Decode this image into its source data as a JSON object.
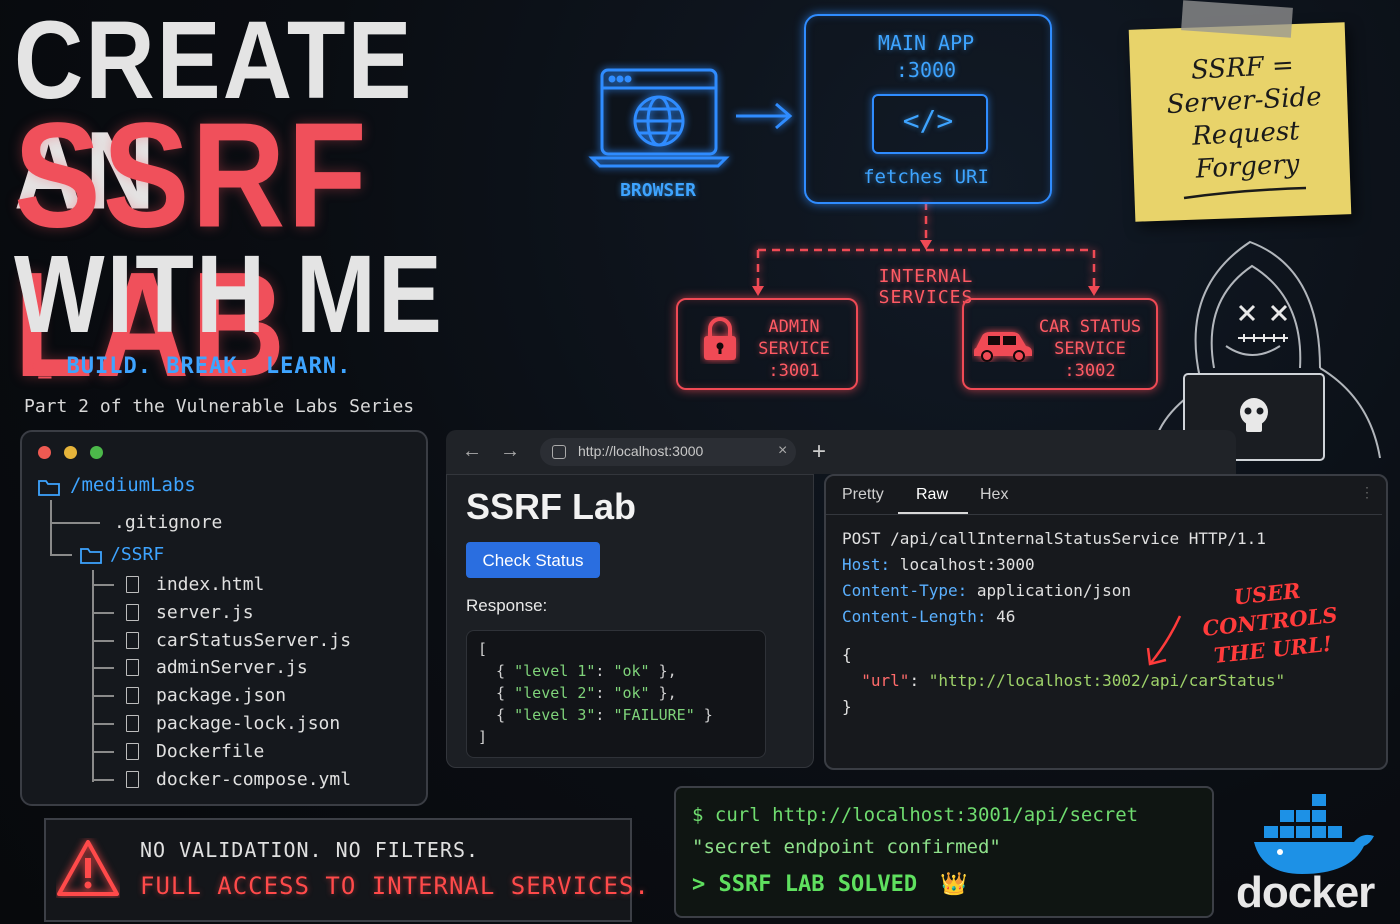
{
  "hero": {
    "line1": "CREATE AN",
    "line2": "SSRF LAB",
    "line3": "WITH ME",
    "tagline_prompt": ">_",
    "tagline": "BUILD. BREAK. LEARN.",
    "subtitle": "Part 2 of the Vulnerable Labs Series"
  },
  "diagram": {
    "browser_label": "BROWSER",
    "main_app_line1": "MAIN APP",
    "main_app_line2": ":3000",
    "code_glyph": "</>",
    "fetches_label": "fetches URI",
    "internal_label": "INTERNAL SERVICES",
    "admin_line1": "ADMIN",
    "admin_line2": "SERVICE",
    "admin_line3": ":3001",
    "car_line1": "CAR STATUS",
    "car_line2": "SERVICE",
    "car_line3": ":3002",
    "blue": "#2f8cff",
    "red": "#f04a55"
  },
  "sticky_note": {
    "line1": "SSRF =",
    "line2": "Server-Side",
    "line3": "Request",
    "line4": "Forgery"
  },
  "file_tree": {
    "root": "/mediumLabs",
    "gitignore": ".gitignore",
    "ssrf_folder": "/SSRF",
    "files": [
      "index.html",
      "server.js",
      "carStatusServer.js",
      "adminServer.js",
      "package.json",
      "package-lock.json",
      "Dockerfile",
      "docker-compose.yml"
    ]
  },
  "browser": {
    "url": "http://localhost:3000",
    "title": "SSRF Lab",
    "button_label": "Check Status",
    "response_label": "Response:",
    "response_open": "[",
    "response_rows": [
      {
        "key": "\"level 1\"",
        "value": "\"ok\"",
        "close": " },"
      },
      {
        "key": "\"level 2\"",
        "value": "\"ok\"",
        "close": " },"
      },
      {
        "key": "\"level 3\"",
        "value": "\"FAILURE\"",
        "close": " }"
      }
    ],
    "response_close": "]"
  },
  "request": {
    "tabs": [
      "Pretty",
      "Raw",
      "Hex"
    ],
    "active_tab": "Raw",
    "request_line": "POST /api/callInternalStatusService HTTP/1.1",
    "headers": [
      {
        "key": "Host:",
        "value": " localhost:3000"
      },
      {
        "key": "Content-Type:",
        "value": " application/json"
      },
      {
        "key": "Content-Length:",
        "value": " 46"
      }
    ],
    "body_open": "{",
    "body_key": "\"url\"",
    "body_value": "\"http://localhost:3002/api/carStatus\"",
    "body_close": "}",
    "annotation_line1": "USER CONTROLS",
    "annotation_line2": "THE URL!"
  },
  "warning": {
    "line1": "NO VALIDATION. NO FILTERS.",
    "line2": "FULL ACCESS TO INTERNAL SERVICES."
  },
  "terminal": {
    "line1": "$ curl http://localhost:3001/api/secret",
    "line2": "\"secret endpoint confirmed\"",
    "line3": "> SSRF LAB SOLVED",
    "crown": "👑"
  },
  "docker": {
    "wordmark": "docker",
    "color": "#1d91e6"
  }
}
